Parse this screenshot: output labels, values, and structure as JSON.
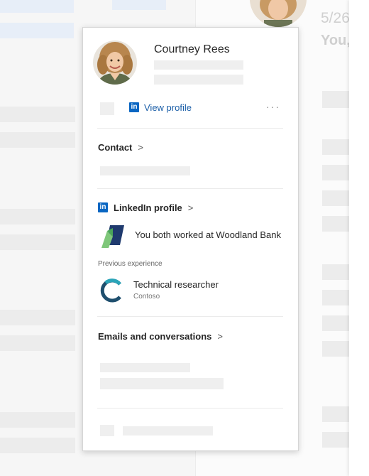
{
  "colors": {
    "linkedin_blue": "#0a66c2",
    "link_text": "#1c5fa8",
    "placeholder": "#efefef"
  },
  "background": {
    "date_text": "5/26",
    "sender_text": "You,"
  },
  "profile": {
    "name": "Courtney Rees",
    "view_profile_label": "View profile",
    "more_label": "···",
    "linkedin_glyph": "in"
  },
  "contact": {
    "heading": "Contact",
    "chevron": ">"
  },
  "linkedin": {
    "heading": "LinkedIn profile",
    "chevron": ">",
    "shared_connection_text": "You both worked at Woodland Bank",
    "previous_experience_label": "Previous experience",
    "role_title": "Technical researcher",
    "role_company": "Contoso"
  },
  "emails": {
    "heading": "Emails and conversations",
    "chevron": ">"
  },
  "icons": [
    "linkedin-icon",
    "more-options-icon",
    "chevron-right-icon",
    "woodland-bank-logo-icon",
    "contoso-logo-icon"
  ]
}
